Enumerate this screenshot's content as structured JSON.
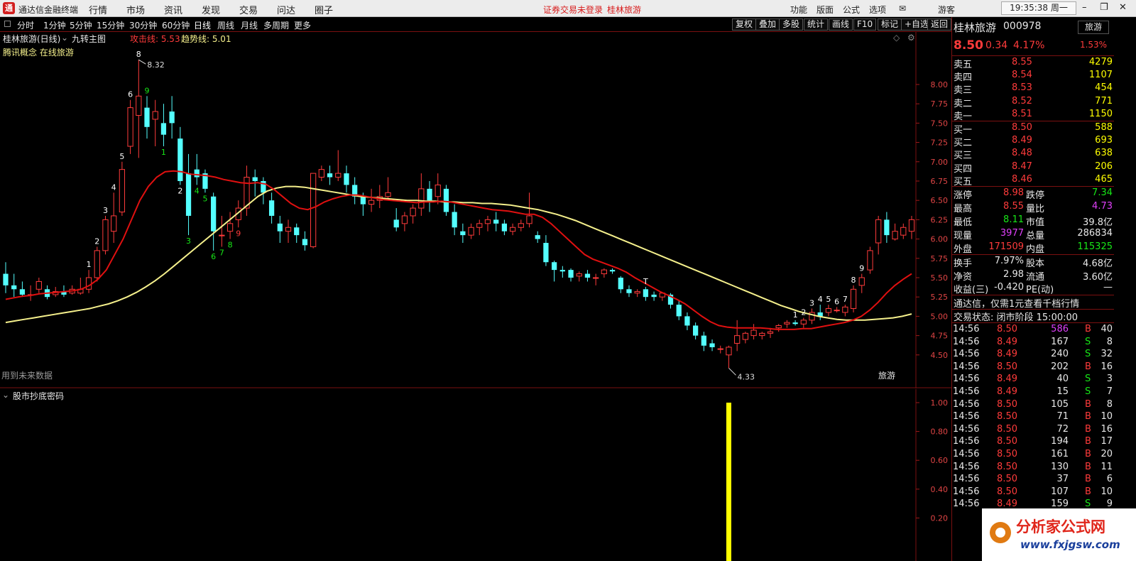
{
  "titlebar": {
    "app_name": "通达信金融终端",
    "menus": [
      "行情",
      "市场",
      "资讯",
      "发现",
      "交易",
      "问达",
      "圈子"
    ],
    "notice": "证券交易未登录",
    "stock": "桂林旅游",
    "right_menus": [
      "功能",
      "版面",
      "公式",
      "选项"
    ],
    "user": "游客",
    "clock": "19:35:38 周一"
  },
  "periods": [
    "分时",
    "1分钟",
    "5分钟",
    "15分钟",
    "30分钟",
    "60分钟",
    "日线",
    "周线",
    "月线",
    "多周期",
    "更多"
  ],
  "active_period": "日线",
  "toolbar": [
    "复权",
    "叠加",
    "多股",
    "统计",
    "画线",
    "F10",
    "标记",
    "+自选",
    "返回"
  ],
  "main_chart": {
    "title": "桂林旅游(日线)",
    "indicator": "九转主图",
    "attack_label": "攻击线: 5.53",
    "trend_label": "趋势线: 5.01",
    "concept": "腾讯概念 在线旅游",
    "future_note": "用到未来数据",
    "tag": "旅游",
    "high_label": "8.32",
    "low_label": "4.33",
    "y_ticks": [
      8.0,
      7.75,
      7.5,
      7.25,
      7.0,
      6.75,
      6.5,
      6.25,
      6.0,
      5.75,
      5.5,
      5.25,
      5.0,
      4.75,
      4.5
    ]
  },
  "sub_chart": {
    "title": "股市抄底密码",
    "y_ticks": [
      "1.00",
      "0.80",
      "0.60",
      "0.40",
      "0.20"
    ]
  },
  "chart_data": {
    "type": "candlestick",
    "title": "桂林旅游(日线)",
    "ylim": [
      4.25,
      8.45
    ],
    "candles": [
      [
        5.55,
        5.7,
        5.4,
        5.3
      ],
      [
        5.4,
        5.55,
        5.35,
        5.25
      ],
      [
        5.35,
        5.45,
        5.28,
        5.25
      ],
      [
        5.28,
        5.4,
        5.28,
        5.2
      ],
      [
        5.35,
        5.5,
        5.45,
        5.3
      ],
      [
        5.35,
        5.4,
        5.25,
        5.22
      ],
      [
        5.28,
        5.38,
        5.32,
        5.25
      ],
      [
        5.32,
        5.4,
        5.28,
        5.25
      ],
      [
        5.3,
        5.4,
        5.35,
        5.28
      ],
      [
        5.3,
        5.5,
        5.35,
        5.28
      ],
      [
        5.35,
        5.6,
        5.5,
        5.3
      ],
      [
        5.5,
        5.9,
        5.85,
        5.45
      ],
      [
        5.85,
        6.3,
        6.25,
        5.8
      ],
      [
        6.1,
        6.6,
        6.3,
        5.95
      ],
      [
        6.35,
        7.0,
        6.9,
        6.3
      ],
      [
        7.2,
        7.8,
        7.7,
        7.1
      ],
      [
        7.6,
        8.32,
        7.85,
        7.05
      ],
      [
        7.7,
        7.85,
        7.45,
        7.3
      ],
      [
        7.55,
        7.8,
        7.65,
        7.2
      ],
      [
        7.5,
        7.75,
        7.35,
        7.2
      ],
      [
        7.65,
        7.85,
        7.5,
        7.3
      ],
      [
        7.3,
        7.45,
        6.75,
        6.7
      ],
      [
        6.85,
        7.1,
        6.3,
        6.05
      ],
      [
        6.9,
        7.1,
        6.8,
        6.7
      ],
      [
        6.85,
        6.9,
        6.65,
        6.6
      ],
      [
        6.55,
        6.6,
        6.1,
        5.85
      ],
      [
        6.05,
        6.3,
        6.05,
        5.9
      ],
      [
        6.1,
        6.35,
        6.2,
        6.0
      ],
      [
        6.25,
        6.5,
        6.4,
        6.15
      ],
      [
        6.4,
        6.95,
        6.8,
        6.3
      ],
      [
        6.8,
        6.9,
        6.75,
        6.55
      ],
      [
        6.75,
        6.8,
        6.6,
        6.45
      ],
      [
        6.5,
        6.6,
        6.3,
        6.2
      ],
      [
        6.2,
        6.3,
        6.1,
        5.95
      ],
      [
        6.1,
        6.25,
        6.15,
        5.95
      ],
      [
        6.15,
        6.2,
        6.05,
        5.95
      ],
      [
        6.0,
        6.1,
        5.92,
        5.85
      ],
      [
        5.9,
        6.8,
        6.85,
        5.88
      ],
      [
        6.8,
        6.95,
        6.9,
        6.75
      ],
      [
        6.85,
        6.95,
        6.8,
        6.7
      ],
      [
        6.8,
        7.15,
        6.85,
        6.75
      ],
      [
        6.85,
        6.95,
        6.7,
        6.6
      ],
      [
        6.7,
        6.8,
        6.55,
        6.45
      ],
      [
        6.55,
        6.6,
        6.45,
        6.3
      ],
      [
        6.45,
        6.65,
        6.5,
        6.35
      ],
      [
        6.5,
        6.7,
        6.55,
        6.4
      ],
      [
        6.55,
        6.8,
        6.6,
        6.5
      ],
      [
        6.25,
        6.4,
        6.15,
        6.1
      ],
      [
        6.2,
        6.35,
        6.3,
        6.1
      ],
      [
        6.3,
        6.45,
        6.4,
        6.2
      ],
      [
        6.4,
        6.85,
        6.65,
        6.3
      ],
      [
        6.65,
        6.75,
        6.5,
        6.35
      ],
      [
        6.55,
        6.85,
        6.7,
        6.45
      ],
      [
        6.65,
        6.7,
        6.35,
        6.3
      ],
      [
        6.35,
        6.45,
        6.15,
        6.05
      ],
      [
        6.1,
        6.2,
        6.05,
        5.95
      ],
      [
        6.05,
        6.2,
        6.15,
        6.0
      ],
      [
        6.15,
        6.25,
        6.2,
        6.05
      ],
      [
        6.2,
        6.3,
        6.25,
        6.1
      ],
      [
        6.25,
        6.35,
        6.2,
        6.1
      ],
      [
        6.2,
        6.25,
        6.1,
        6.05
      ],
      [
        6.1,
        6.2,
        6.15,
        6.05
      ],
      [
        6.15,
        6.25,
        6.2,
        6.1
      ],
      [
        6.2,
        6.6,
        6.3,
        6.15
      ],
      [
        6.05,
        6.1,
        6.0,
        5.95
      ],
      [
        5.95,
        6.05,
        5.7,
        5.65
      ],
      [
        5.7,
        5.72,
        5.6,
        5.45
      ],
      [
        5.6,
        5.65,
        5.58,
        5.5
      ],
      [
        5.6,
        5.62,
        5.5,
        5.45
      ],
      [
        5.52,
        5.58,
        5.55,
        5.45
      ],
      [
        5.55,
        5.6,
        5.5,
        5.45
      ],
      [
        5.5,
        5.55,
        5.5,
        5.4
      ],
      [
        5.55,
        5.62,
        5.6,
        5.5
      ],
      [
        5.6,
        5.62,
        5.58,
        5.55
      ],
      [
        5.5,
        5.52,
        5.35,
        5.3
      ],
      [
        5.35,
        5.4,
        5.3,
        5.25
      ],
      [
        5.3,
        5.35,
        5.32,
        5.25
      ],
      [
        5.35,
        5.38,
        5.25,
        5.2
      ],
      [
        5.28,
        5.32,
        5.25,
        5.2
      ],
      [
        5.25,
        5.3,
        5.3,
        5.2
      ],
      [
        5.28,
        5.3,
        5.15,
        5.1
      ],
      [
        5.15,
        5.2,
        5.0,
        4.95
      ],
      [
        5.0,
        5.05,
        4.88,
        4.82
      ],
      [
        4.88,
        4.92,
        4.75,
        4.7
      ],
      [
        4.75,
        4.8,
        4.62,
        4.55
      ],
      [
        4.65,
        4.7,
        4.6,
        4.55
      ],
      [
        4.58,
        4.62,
        4.58,
        4.52
      ],
      [
        4.5,
        4.62,
        4.6,
        4.33
      ],
      [
        4.65,
        4.95,
        4.75,
        4.55
      ],
      [
        4.7,
        4.8,
        4.78,
        4.65
      ],
      [
        4.75,
        4.9,
        4.82,
        4.7
      ],
      [
        4.75,
        4.8,
        4.78,
        4.7
      ],
      [
        4.78,
        4.85,
        4.8,
        4.72
      ],
      [
        4.85,
        4.9,
        4.88,
        4.8
      ],
      [
        4.9,
        4.95,
        4.92,
        4.85
      ],
      [
        4.92,
        4.95,
        4.9,
        4.88
      ],
      [
        4.9,
        4.98,
        4.95,
        4.85
      ],
      [
        4.95,
        5.1,
        5.05,
        4.9
      ],
      [
        5.05,
        5.15,
        5.0,
        4.95
      ],
      [
        5.05,
        5.15,
        5.1,
        5.0
      ],
      [
        5.08,
        5.12,
        5.08,
        5.05
      ],
      [
        5.05,
        5.15,
        5.12,
        5.0
      ],
      [
        5.1,
        5.4,
        5.35,
        5.05
      ],
      [
        5.4,
        5.55,
        5.5,
        5.3
      ],
      [
        5.6,
        5.9,
        5.85,
        5.55
      ],
      [
        5.95,
        6.3,
        6.25,
        5.8
      ],
      [
        6.25,
        6.35,
        6.05,
        5.95
      ],
      [
        6.0,
        6.2,
        6.1,
        5.98
      ],
      [
        6.05,
        6.2,
        6.15,
        6.0
      ],
      [
        6.1,
        6.3,
        6.25,
        6.0
      ]
    ],
    "attack_line": [
      5.22,
      5.24,
      5.26,
      5.27,
      5.29,
      5.3,
      5.31,
      5.32,
      5.33,
      5.35,
      5.4,
      5.48,
      5.6,
      5.8,
      6.0,
      6.25,
      6.5,
      6.68,
      6.8,
      6.87,
      6.88,
      6.87,
      6.84,
      6.83,
      6.82,
      6.8,
      6.77,
      6.75,
      6.73,
      6.72,
      6.73,
      6.71,
      6.64,
      6.55,
      6.46,
      6.4,
      6.38,
      6.42,
      6.48,
      6.52,
      6.55,
      6.57,
      6.57,
      6.55,
      6.53,
      6.51,
      6.5,
      6.49,
      6.48,
      6.47,
      6.48,
      6.48,
      6.49,
      6.48,
      6.46,
      6.44,
      6.42,
      6.4,
      6.38,
      6.37,
      6.36,
      6.34,
      6.32,
      6.32,
      6.28,
      6.2,
      6.1,
      6.0,
      5.9,
      5.8,
      5.74,
      5.7,
      5.66,
      5.62,
      5.57,
      5.5,
      5.44,
      5.38,
      5.32,
      5.27,
      5.22,
      5.16,
      5.08,
      5.0,
      4.93,
      4.88,
      4.86,
      4.85,
      4.85,
      4.85,
      4.85,
      4.84,
      4.83,
      4.83,
      4.83,
      4.84,
      4.84,
      4.86,
      4.88,
      4.9,
      4.92,
      4.95,
      5.0,
      5.08,
      5.18,
      5.3,
      5.4,
      5.48,
      5.55
    ],
    "trend_line": [
      4.92,
      4.94,
      4.96,
      4.98,
      5.0,
      5.02,
      5.04,
      5.06,
      5.08,
      5.1,
      5.13,
      5.16,
      5.2,
      5.25,
      5.31,
      5.38,
      5.46,
      5.55,
      5.65,
      5.75,
      5.85,
      5.95,
      6.05,
      6.15,
      6.25,
      6.35,
      6.45,
      6.55,
      6.62,
      6.66,
      6.68,
      6.68,
      6.67,
      6.65,
      6.63,
      6.61,
      6.59,
      6.57,
      6.55,
      6.54,
      6.53,
      6.52,
      6.51,
      6.5,
      6.5,
      6.49,
      6.49,
      6.48,
      6.48,
      6.47,
      6.47,
      6.46,
      6.46,
      6.45,
      6.44,
      6.42,
      6.4,
      6.38,
      6.35,
      6.32,
      6.28,
      6.24,
      6.19,
      6.14,
      6.09,
      6.04,
      5.99,
      5.94,
      5.89,
      5.84,
      5.79,
      5.74,
      5.69,
      5.64,
      5.59,
      5.54,
      5.49,
      5.44,
      5.39,
      5.34,
      5.29,
      5.24,
      5.19,
      5.14,
      5.1,
      5.06,
      5.03,
      5.0,
      4.98,
      4.96,
      4.95,
      4.95,
      4.95,
      4.96,
      4.97,
      4.98,
      5.0,
      5.03
    ],
    "td_labels": [
      {
        "i": 10,
        "t": "1",
        "c": "#ffffff",
        "pos": "above"
      },
      {
        "i": 11,
        "t": "2",
        "c": "#ffffff",
        "pos": "above"
      },
      {
        "i": 12,
        "t": "3",
        "c": "#ffffff",
        "pos": "above"
      },
      {
        "i": 13,
        "t": "4",
        "c": "#ffffff",
        "pos": "above"
      },
      {
        "i": 14,
        "t": "5",
        "c": "#ffffff",
        "pos": "above"
      },
      {
        "i": 15,
        "t": "6",
        "c": "#ffffff",
        "pos": "above"
      },
      {
        "i": 16,
        "t": "8",
        "c": "#ffffff",
        "pos": "above"
      },
      {
        "i": 17,
        "t": "9",
        "c": "#17e817",
        "pos": "above"
      },
      {
        "i": 19,
        "t": "1",
        "c": "#17e817",
        "pos": "below"
      },
      {
        "i": 21,
        "t": "2",
        "c": "#ffffff",
        "pos": "below"
      },
      {
        "i": 22,
        "t": "3",
        "c": "#17e817",
        "pos": "below"
      },
      {
        "i": 23,
        "t": "4",
        "c": "#17e817",
        "pos": "below"
      },
      {
        "i": 24,
        "t": "5",
        "c": "#17e817",
        "pos": "below"
      },
      {
        "i": 25,
        "t": "6",
        "c": "#17e817",
        "pos": "below"
      },
      {
        "i": 26,
        "t": "7",
        "c": "#17e817",
        "pos": "below"
      },
      {
        "i": 27,
        "t": "8",
        "c": "#17e817",
        "pos": "below"
      },
      {
        "i": 28,
        "t": "9",
        "c": "#ff3b3b",
        "pos": "below"
      },
      {
        "i": 77,
        "t": "T",
        "c": "#ffffff",
        "pos": "above"
      },
      {
        "i": 95,
        "t": "1",
        "c": "#ffffff",
        "pos": "above"
      },
      {
        "i": 96,
        "t": "2",
        "c": "#ffffff",
        "pos": "above"
      },
      {
        "i": 97,
        "t": "3",
        "c": "#ffffff",
        "pos": "above"
      },
      {
        "i": 98,
        "t": "4",
        "c": "#ffffff",
        "pos": "above"
      },
      {
        "i": 99,
        "t": "5",
        "c": "#ffffff",
        "pos": "above"
      },
      {
        "i": 100,
        "t": "6",
        "c": "#ffffff",
        "pos": "above"
      },
      {
        "i": 101,
        "t": "7",
        "c": "#ffffff",
        "pos": "above"
      },
      {
        "i": 102,
        "t": "8",
        "c": "#ffffff",
        "pos": "above"
      },
      {
        "i": 103,
        "t": "9",
        "c": "#ffffff",
        "pos": "above"
      }
    ],
    "signal": {
      "index": 87,
      "value": 1.0,
      "color": "#ffff00"
    },
    "colors": {
      "up": "#ff3b3b",
      "down": "#54ffff",
      "attack": "#e01010",
      "trend": "#f5f08c"
    }
  },
  "quote": {
    "name": "桂林旅游",
    "code": "000978",
    "sector": "旅游",
    "price": "8.50",
    "change": "0.34",
    "pct": "4.17%",
    "sector_pct": "1.53%",
    "sells": [
      {
        "label": "卖五",
        "price": "8.55",
        "vol": "4279"
      },
      {
        "label": "卖四",
        "price": "8.54",
        "vol": "1107"
      },
      {
        "label": "卖三",
        "price": "8.53",
        "vol": "454"
      },
      {
        "label": "卖二",
        "price": "8.52",
        "vol": "771"
      },
      {
        "label": "卖一",
        "price": "8.51",
        "vol": "1150"
      }
    ],
    "buys": [
      {
        "label": "买一",
        "price": "8.50",
        "vol": "588"
      },
      {
        "label": "买二",
        "price": "8.49",
        "vol": "693"
      },
      {
        "label": "买三",
        "price": "8.48",
        "vol": "638"
      },
      {
        "label": "买四",
        "price": "8.47",
        "vol": "206"
      },
      {
        "label": "买五",
        "price": "8.46",
        "vol": "465"
      }
    ],
    "stats": [
      {
        "l1": "涨停",
        "v1": "8.98",
        "c1": "red",
        "l2": "跌停",
        "v2": "7.34",
        "c2": "green"
      },
      {
        "l1": "最高",
        "v1": "8.55",
        "c1": "red",
        "l2": "量比",
        "v2": "4.73",
        "c2": "magenta"
      },
      {
        "l1": "最低",
        "v1": "8.11",
        "c1": "green",
        "l2": "市值",
        "v2": "39.8亿",
        "c2": "white"
      },
      {
        "l1": "现量",
        "v1": "3977",
        "c1": "magenta",
        "l2": "总量",
        "v2": "286834",
        "c2": "white"
      },
      {
        "l1": "外盘",
        "v1": "171509",
        "c1": "red",
        "l2": "内盘",
        "v2": "115325",
        "c2": "green"
      }
    ],
    "fin": [
      {
        "l1": "换手",
        "v1": "7.97%",
        "l2": "股本",
        "v2": "4.68亿"
      },
      {
        "l1": "净资",
        "v1": "2.98",
        "l2": "流通",
        "v2": "3.60亿"
      },
      {
        "l1": "收益(三)",
        "v1": "-0.420",
        "l2": "PE(动)",
        "v2": "—"
      }
    ],
    "promo": "通达信，仅需1元查看千档行情",
    "trade_state": "交易状态: 闭市阶段 15:00:00",
    "ticks": [
      {
        "time": "14:56",
        "price": "8.50",
        "vol": "586",
        "bs": "B",
        "n": "40",
        "pc": "red",
        "vc": "magenta"
      },
      {
        "time": "14:56",
        "price": "8.49",
        "vol": "167",
        "bs": "S",
        "n": "8",
        "pc": "red",
        "vc": "white"
      },
      {
        "time": "14:56",
        "price": "8.49",
        "vol": "240",
        "bs": "S",
        "n": "32",
        "pc": "red",
        "vc": "white"
      },
      {
        "time": "14:56",
        "price": "8.50",
        "vol": "202",
        "bs": "B",
        "n": "16",
        "pc": "red",
        "vc": "white"
      },
      {
        "time": "14:56",
        "price": "8.49",
        "vol": "40",
        "bs": "S",
        "n": "3",
        "pc": "red",
        "vc": "white"
      },
      {
        "time": "14:56",
        "price": "8.49",
        "vol": "15",
        "bs": "S",
        "n": "7",
        "pc": "red",
        "vc": "white"
      },
      {
        "time": "14:56",
        "price": "8.50",
        "vol": "105",
        "bs": "B",
        "n": "8",
        "pc": "red",
        "vc": "white"
      },
      {
        "time": "14:56",
        "price": "8.50",
        "vol": "71",
        "bs": "B",
        "n": "10",
        "pc": "red",
        "vc": "white"
      },
      {
        "time": "14:56",
        "price": "8.50",
        "vol": "72",
        "bs": "B",
        "n": "16",
        "pc": "red",
        "vc": "white"
      },
      {
        "time": "14:56",
        "price": "8.50",
        "vol": "194",
        "bs": "B",
        "n": "17",
        "pc": "red",
        "vc": "white"
      },
      {
        "time": "14:56",
        "price": "8.50",
        "vol": "161",
        "bs": "B",
        "n": "20",
        "pc": "red",
        "vc": "white"
      },
      {
        "time": "14:56",
        "price": "8.50",
        "vol": "130",
        "bs": "B",
        "n": "11",
        "pc": "red",
        "vc": "white"
      },
      {
        "time": "14:56",
        "price": "8.50",
        "vol": "37",
        "bs": "B",
        "n": "6",
        "pc": "red",
        "vc": "white"
      },
      {
        "time": "14:56",
        "price": "8.50",
        "vol": "107",
        "bs": "B",
        "n": "10",
        "pc": "red",
        "vc": "white"
      },
      {
        "time": "14:56",
        "price": "8.49",
        "vol": "159",
        "bs": "S",
        "n": "9",
        "pc": "red",
        "vc": "white"
      }
    ]
  },
  "watermark": {
    "title": "分析家公式网",
    "url": "www.fxjgsw.com"
  }
}
